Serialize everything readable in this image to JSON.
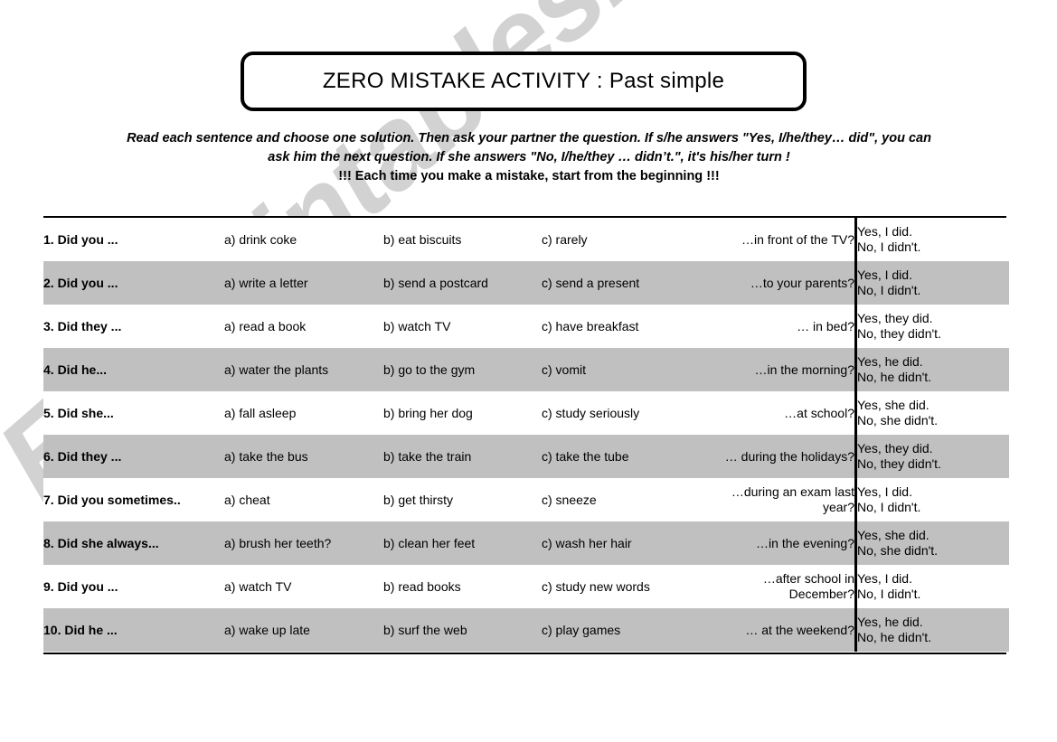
{
  "title": "ZERO MISTAKE ACTIVITY : Past simple",
  "instructions": {
    "line1": "Read each sentence and choose one solution. Then ask your partner the question. If s/he answers \"Yes, I/he/they…  did\", you can",
    "line2": "ask him the next question. If she answers \"No, I/he/they … didn’t.\", it's his/her turn !",
    "line3": "!!! Each time you make a mistake, start from the beginning !!!"
  },
  "watermark": "ESLprintables.com",
  "colors": {
    "shaded_row": "#c0c0c0",
    "rule": "#000000",
    "watermark": "#d2d2d2"
  },
  "table": {
    "rows": [
      {
        "prompt": "1. Did you ...",
        "a": "a) drink coke",
        "b": "b) eat biscuits",
        "c": "c) rarely",
        "ending": "…in front of the TV?",
        "answer_yes": "Yes, I did.",
        "answer_no": "No, I didn't.",
        "shaded": false
      },
      {
        "prompt": "2. Did you ...",
        "a": "a) write a letter",
        "b": "b)  send a postcard",
        "c": "c) send a present",
        "ending": "…to your parents?",
        "answer_yes": "Yes, I did.",
        "answer_no": "No, I didn't.",
        "shaded": true
      },
      {
        "prompt": "3. Did they ...",
        "a": "a) read a book",
        "b": "b) watch TV",
        "c": "c) have breakfast",
        "ending": "… in bed?",
        "answer_yes": "Yes, they did.",
        "answer_no": "No, they didn't.",
        "shaded": false
      },
      {
        "prompt": "4. Did he...",
        "a": "a) water the plants",
        "b": "b) go to the gym",
        "c": "c) vomit",
        "ending": "…in the morning?",
        "answer_yes": "Yes, he did.",
        "answer_no": "No, he didn't.",
        "shaded": true
      },
      {
        "prompt": "5. Did she...",
        "a": "a) fall asleep",
        "b": "b) bring her dog",
        "c": "c) study seriously",
        "ending": "…at school?",
        "answer_yes": "Yes, she did.",
        "answer_no": "No, she didn't.",
        "shaded": false
      },
      {
        "prompt": "6. Did they ...",
        "a": "a) take the bus",
        "b": "b) take the train",
        "c": "c) take the tube",
        "ending": "… during the holidays?",
        "answer_yes": "Yes, they did.",
        "answer_no": "No, they didn't.",
        "shaded": true
      },
      {
        "prompt": "7. Did you sometimes..",
        "a": "a) cheat",
        "b": "b) get thirsty",
        "c": "c) sneeze",
        "ending": "…during an exam last year?",
        "answer_yes": "Yes, I did.",
        "answer_no": "No, I didn't.",
        "shaded": false
      },
      {
        "prompt": "8. Did she always...",
        "a": "a) brush her teeth?",
        "b": "b) clean her feet",
        "c": "c) wash her hair",
        "ending": "…in the evening?",
        "answer_yes": "Yes, she did.",
        "answer_no": "No, she didn't.",
        "shaded": true
      },
      {
        "prompt": "9. Did you ...",
        "a": "a) watch TV",
        "b": "b) read books",
        "c": "c) study new words",
        "ending": "…after school in December?",
        "answer_yes": "Yes, I did.",
        "answer_no": "No, I didn't.",
        "shaded": false
      },
      {
        "prompt": "10. Did he ...",
        "a": "a) wake up late",
        "b": "b) surf the web",
        "c": "c) play games",
        "ending": "… at the weekend?",
        "answer_yes": "Yes, he did.",
        "answer_no": "No, he didn't.",
        "shaded": true
      }
    ]
  }
}
